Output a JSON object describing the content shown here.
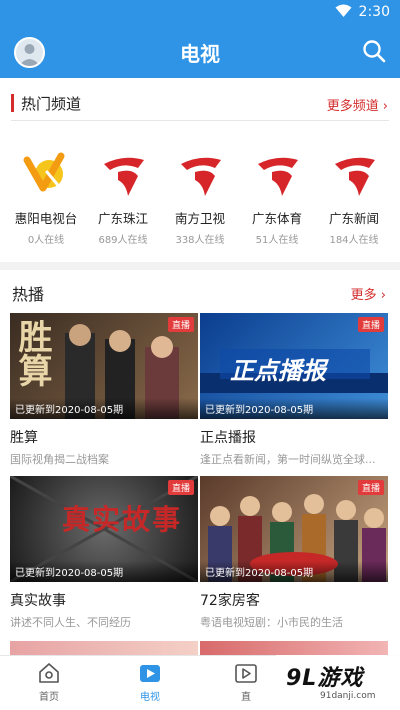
{
  "status_bar": {
    "time": "2:30",
    "icons": [
      "wifi-icon"
    ]
  },
  "app_bar": {
    "title": "电视",
    "left_icon": "avatar",
    "right_icon": "search-icon"
  },
  "hot_channels": {
    "title": "热门频道",
    "more_label": "更多频道",
    "items": [
      {
        "name": "惠阳电视台",
        "online": "0人在线",
        "logo": "huiyang-logo"
      },
      {
        "name": "广东珠江",
        "online": "689人在线",
        "logo": "guangdong-logo"
      },
      {
        "name": "南方卫视",
        "online": "338人在线",
        "logo": "guangdong-logo"
      },
      {
        "name": "广东体育",
        "online": "51人在线",
        "logo": "guangdong-logo"
      },
      {
        "name": "广东新闻",
        "online": "184人在线",
        "logo": "guangdong-logo"
      }
    ]
  },
  "broadcasts": {
    "title": "热播",
    "more_label": "更多",
    "items": [
      {
        "title": "胜算",
        "desc": "国际视角揭二战档案",
        "badge": "直播",
        "update": "已更新到2020-08-05期",
        "thumb_text": "胜算",
        "colors": [
          "#3a2c22",
          "#8a6a4a"
        ]
      },
      {
        "title": "正点播报",
        "desc": "逢正点看新闻，第一时间纵览全球...",
        "badge": "直播",
        "update": "已更新到2020-08-05期",
        "thumb_text": "正点播报",
        "colors": [
          "#0b3d8f",
          "#3f8fd8"
        ]
      },
      {
        "title": "真实故事",
        "desc": "讲述不同人生、不同经历",
        "badge": "直播",
        "update": "已更新到2020-08-05期",
        "thumb_text": "真实故事",
        "colors": [
          "#1a1a1a",
          "#6a6a6a"
        ]
      },
      {
        "title": "72家房客",
        "desc": "粤语电视短剧：小市民的生活",
        "badge": "直播",
        "update": "已更新到2020-08-05期",
        "thumb_text": "",
        "colors": [
          "#5a3a2a",
          "#c7a582"
        ]
      }
    ]
  },
  "tab_bar": {
    "items": [
      {
        "label": "首页",
        "icon": "home-icon",
        "active": false
      },
      {
        "label": "电视",
        "icon": "tv-play-icon",
        "active": true
      },
      {
        "label": "直",
        "icon": "live-icon",
        "active": false
      }
    ]
  },
  "watermark": {
    "main": "9L游戏",
    "url": "91danji.com"
  },
  "colors": {
    "primary": "#2f94e6",
    "accent_red": "#d42b2b",
    "badge_red": "#e23b3b"
  }
}
